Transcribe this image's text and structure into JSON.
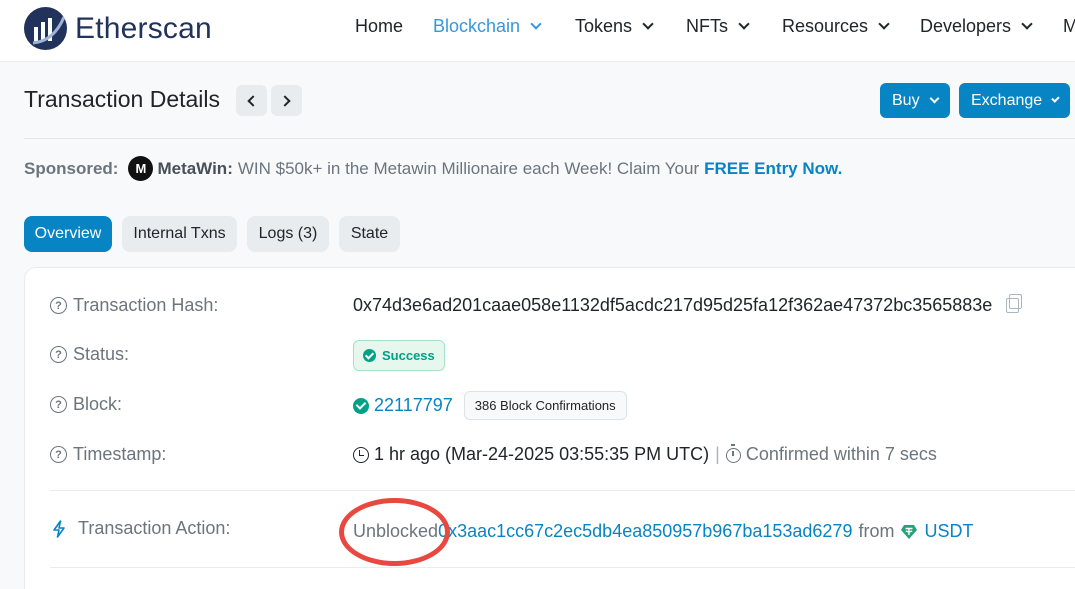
{
  "header": {
    "logo_text": "Etherscan",
    "nav": [
      {
        "label": "Home",
        "active": false,
        "dropdown": false
      },
      {
        "label": "Blockchain",
        "active": true,
        "dropdown": true
      },
      {
        "label": "Tokens",
        "active": false,
        "dropdown": true
      },
      {
        "label": "NFTs",
        "active": false,
        "dropdown": true
      },
      {
        "label": "Resources",
        "active": false,
        "dropdown": true
      },
      {
        "label": "Developers",
        "active": false,
        "dropdown": true
      },
      {
        "label": "M",
        "active": false,
        "dropdown": false
      }
    ]
  },
  "page": {
    "title": "Transaction Details",
    "buy_label": "Buy",
    "exchange_label": "Exchange"
  },
  "sponsored": {
    "label": "Sponsored:",
    "brand_icon": "M",
    "brand": "MetaWin:",
    "text": "WIN $50k+ in the Metawin Millionaire each Week! Claim Your",
    "cta": "FREE Entry Now."
  },
  "tabs": [
    {
      "label": "Overview",
      "active": true
    },
    {
      "label": "Internal Txns",
      "active": false
    },
    {
      "label": "Logs (3)",
      "active": false
    },
    {
      "label": "State",
      "active": false
    }
  ],
  "details": {
    "hash_label": "Transaction Hash:",
    "hash_value": "0x74d3e6ad201caae058e1132df5acdc217d95d25fa12f362ae47372bc3565883e",
    "status_label": "Status:",
    "status_value": "Success",
    "block_label": "Block:",
    "block_value": "22117797",
    "block_confirmations": "386 Block Confirmations",
    "timestamp_label": "Timestamp:",
    "timestamp_value": "1 hr ago (Mar-24-2025 03:55:35 PM UTC)",
    "timestamp_separator": "|",
    "confirmed_within": "Confirmed within 7 secs",
    "action_label": "Transaction Action:",
    "action_verb": "Unblocked",
    "action_address": "0x3aac1cc67c2ec5db4ea850957b967ba153ad6279",
    "action_from": "from",
    "action_token": "USDT"
  },
  "colors": {
    "brand_blue": "#0784c3",
    "nav_active": "#3498db",
    "success_green": "#00a186",
    "tether_green": "#26a17b",
    "annotation_red": "#e8483f"
  }
}
